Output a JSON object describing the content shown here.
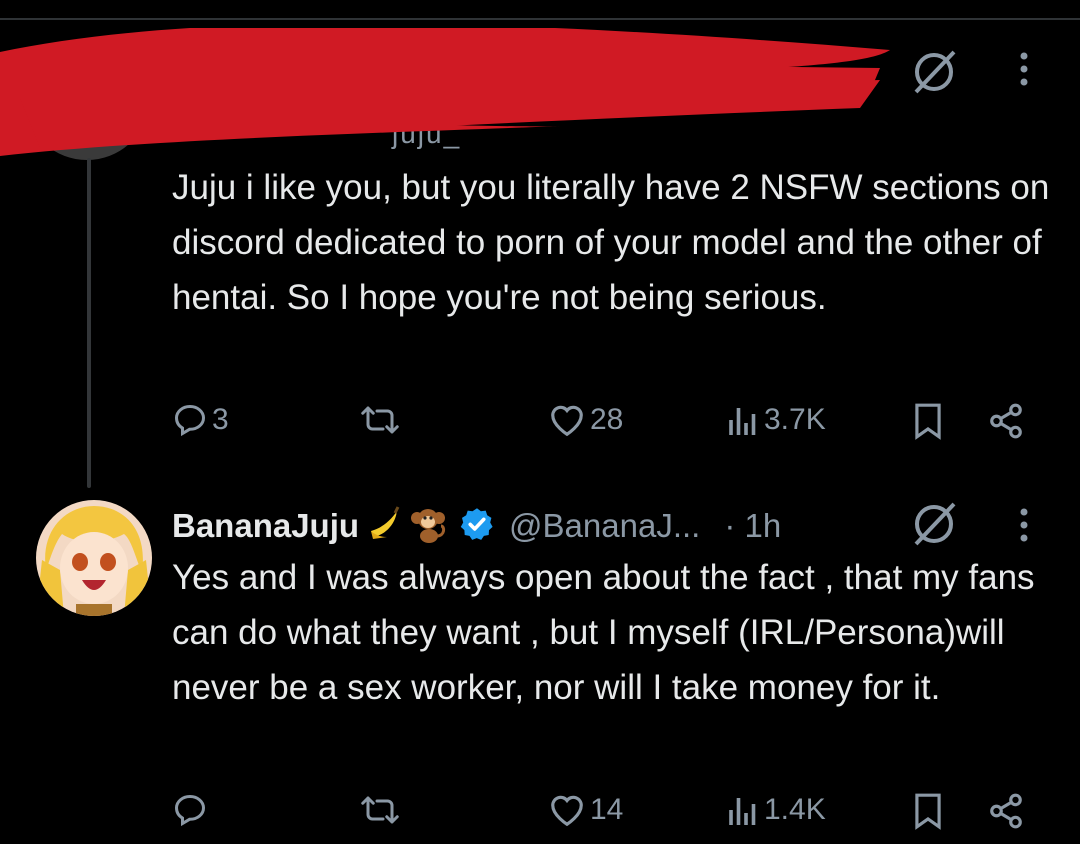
{
  "reply_tweet": {
    "handle_fragment": "juju_",
    "text": "Juju i like you, but you literally have 2 NSFW sections on discord dedicated to porn of your model and the other of hentai. So I hope you're not being serious.",
    "replies": "3",
    "retweets": "",
    "likes": "28",
    "views": "3.7K",
    "icons": [
      "grok-icon",
      "more-icon",
      "reply-icon",
      "retweet-icon",
      "like-icon",
      "views-icon",
      "bookmark-icon",
      "share-icon"
    ]
  },
  "main_tweet": {
    "name": "BananaJuju",
    "emojis": [
      "banana",
      "monkey"
    ],
    "verified": true,
    "handle": "@BananaJ...",
    "time": "· 1h",
    "text": "Yes and I was always open about the fact , that my fans can do what they want , but I myself (IRL/Persona)will never  be a sex worker, nor will I take money for it.",
    "replies": "",
    "retweets": "",
    "likes": "14",
    "views": "1.4K"
  },
  "colors": {
    "background": "#000000",
    "text": "#e7e9ea",
    "muted": "#8b98a5",
    "verified": "#1d9bf0",
    "redaction": "#d01a24"
  }
}
